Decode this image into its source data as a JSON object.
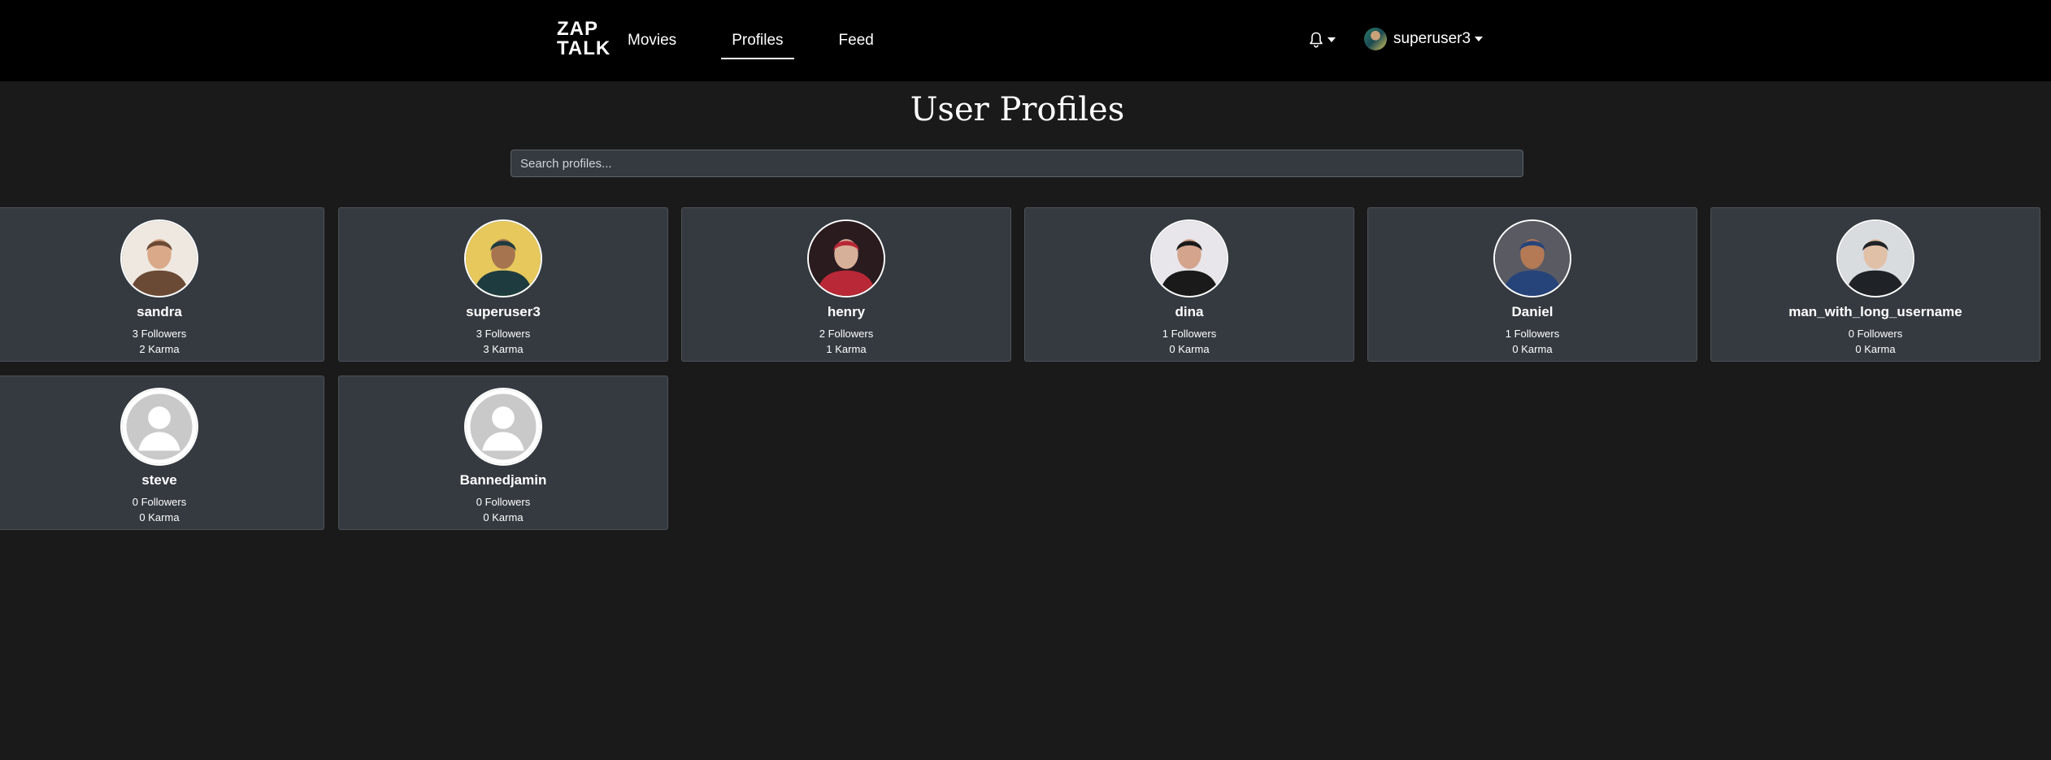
{
  "header": {
    "logo_top": "ZAP",
    "logo_bottom": "TALK",
    "nav": [
      {
        "label": "Movies",
        "active": false
      },
      {
        "label": "Profiles",
        "active": true
      },
      {
        "label": "Feed",
        "active": false
      }
    ],
    "notifications_icon": "bell-icon",
    "username": "superuser3"
  },
  "main": {
    "title": "User Profiles",
    "search_placeholder": "Search profiles...",
    "profiles": [
      {
        "name": "sandra",
        "followers": "3 Followers",
        "karma": "2 Karma",
        "avatar": "photo",
        "photo_colors": [
          "#efe8e0",
          "#6b4a35",
          "#d9a98a"
        ]
      },
      {
        "name": "superuser3",
        "followers": "3 Followers",
        "karma": "3 Karma",
        "avatar": "photo",
        "photo_colors": [
          "#e6c85c",
          "#1e3c3f",
          "#a77450"
        ]
      },
      {
        "name": "henry",
        "followers": "2 Followers",
        "karma": "1 Karma",
        "avatar": "photo",
        "photo_colors": [
          "#2a1b1f",
          "#b82836",
          "#d7b09a"
        ]
      },
      {
        "name": "dina",
        "followers": "1 Followers",
        "karma": "0 Karma",
        "avatar": "photo",
        "photo_colors": [
          "#e8e6ea",
          "#1a1a1a",
          "#d4a48d"
        ]
      },
      {
        "name": "Daniel",
        "followers": "1 Followers",
        "karma": "0 Karma",
        "avatar": "photo",
        "photo_colors": [
          "#5a5a62",
          "#27447a",
          "#b47a55"
        ]
      },
      {
        "name": "man_with_long_username",
        "followers": "0 Followers",
        "karma": "0 Karma",
        "avatar": "photo",
        "photo_colors": [
          "#d8dcdf",
          "#1f2226",
          "#e1c0a8"
        ]
      },
      {
        "name": "steve",
        "followers": "0 Followers",
        "karma": "0 Karma",
        "avatar": "default",
        "photo_colors": [
          "#c9c9c9",
          "#ffffff",
          "#ffffff"
        ]
      },
      {
        "name": "Bannedjamin",
        "followers": "0 Followers",
        "karma": "0 Karma",
        "avatar": "default",
        "photo_colors": [
          "#c9c9c9",
          "#ffffff",
          "#ffffff"
        ]
      }
    ]
  }
}
